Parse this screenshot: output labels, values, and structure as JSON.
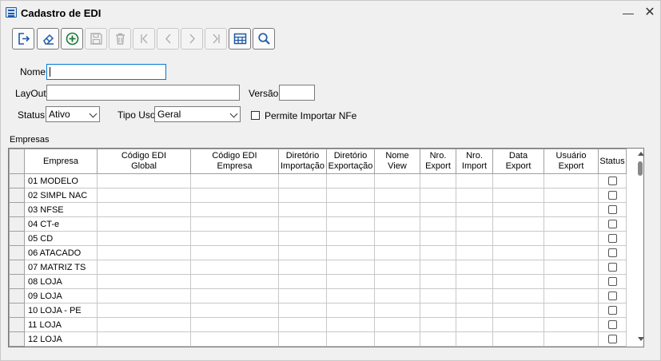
{
  "window": {
    "title": "Cadastro de EDI",
    "minimize": "—",
    "close": "✕"
  },
  "toolbar": [
    {
      "name": "exit-icon",
      "enabled": true
    },
    {
      "name": "eraser-icon",
      "enabled": true
    },
    {
      "name": "add-icon",
      "enabled": true
    },
    {
      "name": "save-icon",
      "enabled": false
    },
    {
      "name": "trash-icon",
      "enabled": false
    },
    {
      "name": "first-record-icon",
      "enabled": false
    },
    {
      "name": "previous-icon",
      "enabled": false
    },
    {
      "name": "next-icon",
      "enabled": false
    },
    {
      "name": "last-record-icon",
      "enabled": false
    },
    {
      "name": "table-icon",
      "enabled": true
    },
    {
      "name": "search-icon",
      "enabled": true
    }
  ],
  "form": {
    "nome_label": "Nome",
    "nome_value": "",
    "layout_label": "LayOut",
    "layout_value": "",
    "versao_label": "Versão",
    "versao_value": "",
    "status_label": "Status",
    "status_value": "Ativo",
    "tipo_uso_label": "Tipo Uso",
    "tipo_uso_value": "Geral",
    "permite_label": "Permite Importar NFe",
    "permite_checked": false
  },
  "empresas": {
    "label": "Empresas",
    "columns": [
      "Empresa",
      "Código EDI\nGlobal",
      "Código EDI\nEmpresa",
      "Diretório\nImportação",
      "Diretório\nExportação",
      "Nome\nView",
      "Nro.\nExport",
      "Nro.\nImport",
      "Data\nExport",
      "Usuário\nExport",
      "Status"
    ],
    "rows": [
      "01 MODELO",
      "02 SIMPL NAC",
      "03 NFSE",
      "04 CT-e",
      "05 CD",
      "06 ATACADO",
      "07 MATRIZ TS",
      "08 LOJA",
      "09 LOJA",
      "10 LOJA - PE",
      "11 LOJA",
      "12 LOJA",
      ""
    ]
  }
}
